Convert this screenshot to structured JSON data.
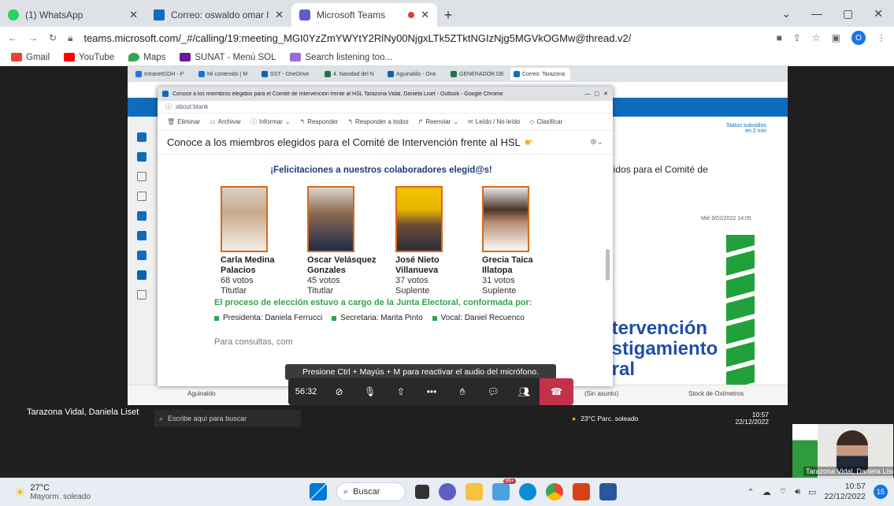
{
  "browser": {
    "tabs": [
      {
        "title": "(1) WhatsApp",
        "color": "#25d366"
      },
      {
        "title": "Correo: oswaldo omar lamas rios",
        "color": "#0f6cbd"
      },
      {
        "title": "Microsoft Teams",
        "color": "#5b5fc7"
      }
    ],
    "url": "teams.microsoft.com/_#/calling/19:meeting_MGI0YzZmYWYtY2RlNy00NjgxLTk5ZTktNGIzNjg5MGVkOGMw@thread.v2/",
    "bookmarks": [
      {
        "label": "Gmail",
        "color": "#ea4335"
      },
      {
        "label": "YouTube",
        "color": "#ff0000"
      },
      {
        "label": "Maps",
        "color": "#34a853"
      },
      {
        "label": "SUNAT - Menú SOL",
        "color": "#6a1b9a"
      },
      {
        "label": "Search listening too...",
        "color": "#9c6ade"
      }
    ]
  },
  "shared_screen": {
    "tabs": [
      "IntranetGDH - P",
      "Mi contenido | M",
      "SST - OneDrive",
      "4. Navidad del N",
      "Aguinaldo - One",
      "GENERADOR DE",
      "Correo: Tarazona"
    ],
    "right_panel": {
      "status_label": "Status subsidios",
      "status_sub": "en 2 min",
      "subject_fragment": "gidos para el Comité de",
      "date": "Mié 9/02/2022 14:05",
      "banner_lines": [
        "ntervención",
        "ostigamiento",
        "oral"
      ]
    },
    "bottom_items": [
      "Aguinaldo",
      "(Sin asunto)",
      "Stock de Oxímetros"
    ],
    "taskbar": {
      "search_placeholder": "Escribe aquí para buscar",
      "weather": "23°C Parc. soleado",
      "time": "10:57",
      "date": "22/12/2022"
    }
  },
  "popup": {
    "window_title": "Conoce a los miembros elegidos para el Comité de Intervención frente al HSL  Tarazona Vidal, Daniela Liset - Outlook - Google Chrome",
    "address": "about:blank",
    "actions": [
      "Eliminar",
      "Archivar",
      "Informar",
      "Responder",
      "Responder a todos",
      "Reenviar",
      "Leído / No leído",
      "Clasificar"
    ],
    "subject": "Conoce a los miembros elegidos para el Comité de Intervención frente al HSL",
    "congrats": "¡Felicitaciones a nuestros colaboradores elegid@s!",
    "candidates": [
      {
        "name1": "Carla Medina",
        "name2": "Palacios",
        "votes": "68 votos",
        "role": "Titutlar"
      },
      {
        "name1": "Oscar Velásquez",
        "name2": "Gonzales",
        "votes": "45 votos",
        "role": "Titutlar"
      },
      {
        "name1": "José Nieto",
        "name2": "Villanueva",
        "votes": "37 votos",
        "role": "Suplente"
      },
      {
        "name1": "Grecia Taica",
        "name2": "Illatopa",
        "votes": "31 votos",
        "role": "Suplente"
      }
    ],
    "process_text": "El proceso de elección estuvo a cargo de la Junta Electoral, conformada por:",
    "junta": [
      "Presidenta: Daniela Ferrucci",
      "Secretaria: Marita Pinto",
      "Vocal: Daniel Recuenco"
    ],
    "consult_text": "Para consultas, com"
  },
  "meeting": {
    "mic_tooltip": "Presione Ctrl + Mayús + M para reactivar el audio del micrófono.",
    "timer": "56:32",
    "presenter_name": "Tarazona Vidal, Daniela Liset",
    "pip_name": "Tarazona Vidal, Daniela Liset"
  },
  "taskbar": {
    "weather_temp": "27°C",
    "weather_desc": "Mayorm. soleado",
    "search": "Buscar",
    "time": "10:57",
    "date": "22/12/2022",
    "notifications": "15"
  }
}
